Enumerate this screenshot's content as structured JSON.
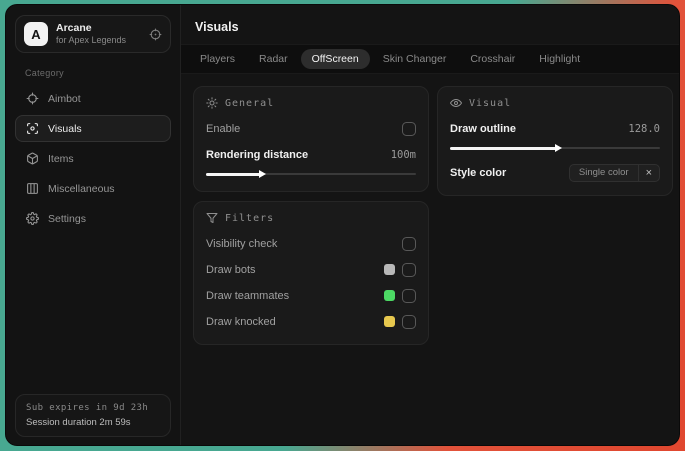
{
  "app": {
    "name": "Arcane",
    "subtitle": "for Apex Legends",
    "logo_letter": "A"
  },
  "sidebar": {
    "category_label": "Category",
    "items": [
      {
        "label": "Aimbot",
        "icon": "crosshair-icon",
        "selected": false
      },
      {
        "label": "Visuals",
        "icon": "scan-eye-icon",
        "selected": true
      },
      {
        "label": "Items",
        "icon": "package-icon",
        "selected": false
      },
      {
        "label": "Miscellaneous",
        "icon": "layout-columns-icon",
        "selected": false
      },
      {
        "label": "Settings",
        "icon": "gear-icon",
        "selected": false
      }
    ],
    "status": {
      "line1": "Sub expires in 9d 23h",
      "line2": "Session duration 2m 59s"
    }
  },
  "header": {
    "title": "Visuals"
  },
  "tabs": {
    "active": "OffScreen",
    "items": [
      {
        "label": "Players"
      },
      {
        "label": "Radar"
      },
      {
        "label": "OffScreen"
      },
      {
        "label": "Skin Changer"
      },
      {
        "label": "Crosshair"
      },
      {
        "label": "Highlight"
      }
    ]
  },
  "panels": {
    "general": {
      "title": "General",
      "icon": "sun-icon",
      "enable": {
        "label": "Enable",
        "checked": false
      },
      "rendering": {
        "label": "Rendering distance",
        "value": "100m",
        "slider_pct": 27
      }
    },
    "visual": {
      "title": "Visual",
      "icon": "eye-icon",
      "draw_outline": {
        "label": "Draw outline",
        "value": "128.0",
        "slider_pct": 52
      },
      "style_color": {
        "label": "Style color",
        "chip_label": "Single color",
        "chip_close": "×"
      }
    },
    "filters": {
      "title": "Filters",
      "icon": "funnel-icon",
      "rows": [
        {
          "label": "Visibility check",
          "checked": false,
          "swatch": null
        },
        {
          "label": "Draw bots",
          "checked": false,
          "swatch": "#b8b8b8"
        },
        {
          "label": "Draw teammates",
          "checked": false,
          "swatch": "#4cd964"
        },
        {
          "label": "Draw knocked",
          "checked": false,
          "swatch": "#e7c84e"
        }
      ]
    }
  },
  "colors": {
    "background_teal": "#48a891",
    "background_orange": "#e2523a",
    "swatch_bots": "#b8b8b8",
    "swatch_teammates": "#4cd964",
    "swatch_knocked": "#e7c84e"
  }
}
